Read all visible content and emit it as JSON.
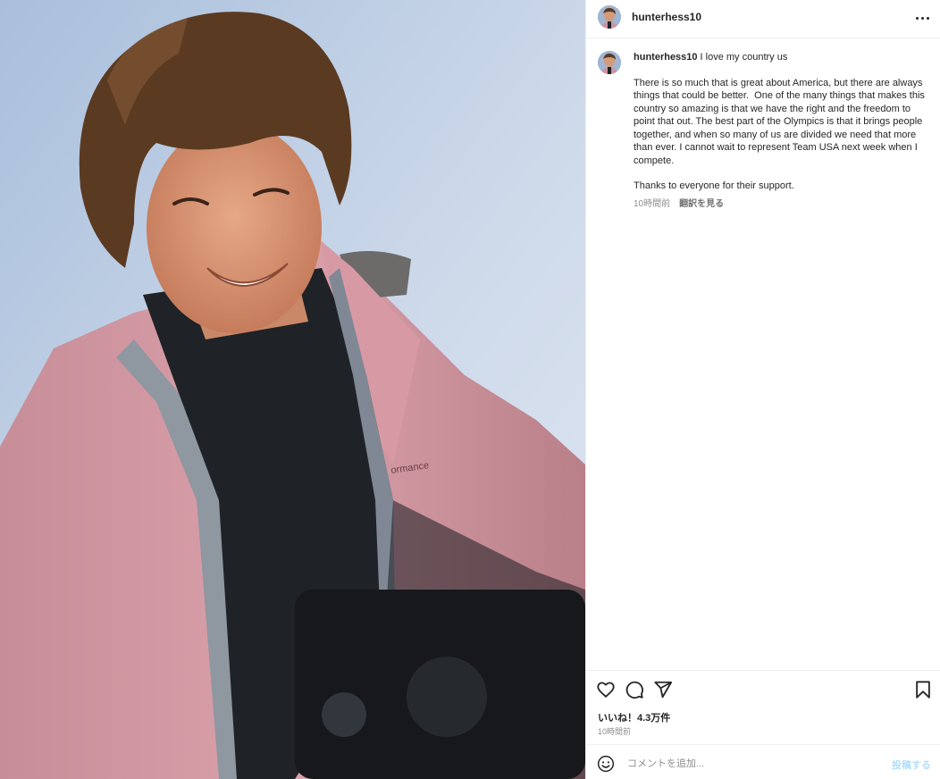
{
  "header": {
    "username": "hunterhess10",
    "more_icon": "more-horizontal-icon"
  },
  "caption": {
    "username": "hunterhess10",
    "first_line": "I love my country us",
    "paragraph1": "There is so much that is great about America, but there are always things that could be better.  One of the many things that makes this country so amazing is that we have the right and the freedom to point that out. The best part of the Olympics is that it brings people together, and when so many of us are divided we need that more than ever. I cannot wait to represent Team USA next week when I compete.",
    "paragraph2": "Thanks to everyone for their support.",
    "time": "10時間前",
    "translate": "翻訳を見る"
  },
  "actions": {
    "icons": [
      "heart-icon",
      "comment-icon",
      "share-icon",
      "bookmark-icon"
    ],
    "likes": "いいね！4.3万件",
    "time": "10時間前"
  },
  "comment": {
    "placeholder": "コメントを追加...",
    "post_label": "投稿する",
    "emoji_icon": "emoji-icon"
  },
  "colors": {
    "accent": "#0095f6",
    "post_disabled": "#b2dffc",
    "jacket": "#d19aa5",
    "sky": "#cdd9ea"
  }
}
